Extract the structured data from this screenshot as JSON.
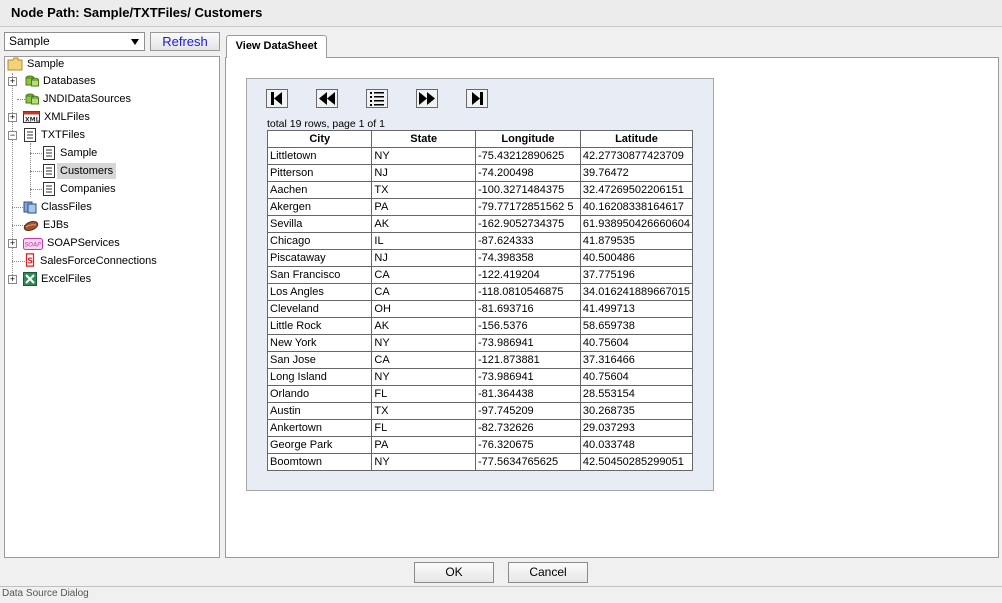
{
  "window": {
    "title": "Node Path: Sample/TXTFiles/ Customers"
  },
  "datasource": {
    "selected": "Sample",
    "refresh_label": "Refresh"
  },
  "tree": {
    "root": "Sample",
    "items": [
      {
        "label": "Databases",
        "icon": "database-icon"
      },
      {
        "label": "JNDIDataSources",
        "icon": "database-icon"
      },
      {
        "label": "XMLFiles",
        "icon": "xml-file-icon"
      },
      {
        "label": "TXTFiles",
        "icon": "text-file-icon"
      },
      {
        "label": "Sample",
        "icon": "text-file-icon"
      },
      {
        "label": "Customers",
        "icon": "text-file-icon"
      },
      {
        "label": "Companies",
        "icon": "text-file-icon"
      },
      {
        "label": "ClassFiles",
        "icon": "class-file-icon"
      },
      {
        "label": "EJBs",
        "icon": "bean-icon"
      },
      {
        "label": "SOAPServices",
        "icon": "soap-icon"
      },
      {
        "label": "SalesForceConnections",
        "icon": "salesforce-icon"
      },
      {
        "label": "ExcelFiles",
        "icon": "excel-icon"
      }
    ]
  },
  "tab": {
    "label": "View DataSheet"
  },
  "sheet": {
    "info": "total 19 rows, page 1 of 1",
    "columns": [
      "City",
      "State",
      "Longitude",
      "Latitude"
    ],
    "rows": [
      [
        "Littletown",
        "NY",
        "-75.43212890625",
        "42.27730877423709"
      ],
      [
        "Pitterson",
        "NJ",
        "-74.200498",
        "39.76472"
      ],
      [
        "Aachen",
        "TX",
        "-100.3271484375",
        "32.47269502206151"
      ],
      [
        "Akergen",
        "PA",
        "-79.77172851562 5",
        "40.16208338164617"
      ],
      [
        "Sevilla",
        "AK",
        "-162.9052734375",
        "61.938950426660604"
      ],
      [
        "Chicago",
        "IL",
        "-87.624333",
        "41.879535"
      ],
      [
        "Piscataway",
        "NJ",
        "-74.398358",
        "40.500486"
      ],
      [
        "San Francisco",
        "CA",
        "-122.419204",
        "37.775196"
      ],
      [
        "Los Angles",
        "CA",
        "-118.0810546875",
        "34.016241889667015"
      ],
      [
        "Cleveland",
        "OH",
        "-81.693716",
        "41.499713"
      ],
      [
        "Little Rock",
        "AK",
        "-156.5376",
        "58.659738"
      ],
      [
        "New York",
        "NY",
        "-73.986941",
        "40.75604"
      ],
      [
        "San Jose",
        "CA",
        "-121.873881",
        "37.316466"
      ],
      [
        "Long Island",
        "NY",
        "-73.986941",
        "40.75604"
      ],
      [
        "Orlando",
        "FL",
        "-81.364438",
        "28.553154"
      ],
      [
        "Austin",
        "TX",
        "-97.745209",
        "30.268735"
      ],
      [
        "Ankertown",
        "FL",
        "-82.732626",
        "29.037293"
      ],
      [
        "George Park",
        "PA",
        "-76.320675",
        "40.033748"
      ],
      [
        "Boomtown",
        "NY",
        "-77.5634765625",
        "42.50450285299051"
      ]
    ]
  },
  "footer": {
    "ok_label": "OK",
    "cancel_label": "Cancel",
    "status": "Data Source Dialog"
  }
}
